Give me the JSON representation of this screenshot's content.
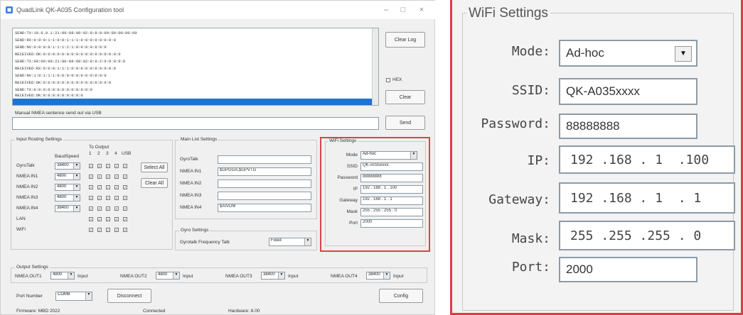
{
  "left_window": {
    "title": "QuadLink QK-A035 Configuration tool",
    "log_lines": [
      "SEND:TX:10.0.0.1:21:00:88:00:02:8:8:0:00:00:00:00:00",
      "SEND:RX:0:0:0:1:1:0:0:1:1:1:0:0:0:0:0:0:0:0",
      "SEND:NV:0:0:0:0:1:1:1:2:1:0:0:0:0:0:0:0",
      "RECEIVED:OK:0:0:0:0:0:0:0:0:0:0:0:0:0:0:0:0:0",
      "SEND:TX:00:00:00:21:00:88:00:02:8:0:2:0:0:0:0:8",
      "RECEIVED:RX:0:0:0:1:1:1:0:0:0:0:0:0:0:0:0:0",
      "SEND:NV:1:0:1:1:1:0:0:0:0:0:0:0:0:0:0:0",
      "RECEIVED:OK:0:0:0:0:0:0:0:0:0:0:0:0:0:0:0",
      "SEND:TX:0:0:0:0:0:0:0:0:0:0:0:0:0",
      "RECEIVED:OK:0:0:0:0:0:0:0:0:0"
    ],
    "buttons": {
      "clear_log": "Clear Log",
      "clear": "Clear",
      "send": "Send",
      "select_all": "Select All",
      "clear_all": "Clear All",
      "disconnect": "Disconnect",
      "config": "Config"
    },
    "hex_label": "HEX",
    "manual_label": "Manual NMEA sentence send out via USB",
    "input_routing": {
      "title": "Input Routing Settings",
      "header_baud": "BaudSpeed",
      "header_out": "To Output",
      "out_cols": [
        "1",
        "2",
        "3",
        "4",
        "USB"
      ],
      "rows": [
        {
          "label": "GyroTalk",
          "baud": "38400"
        },
        {
          "label": "NMEA IN1",
          "baud": "4800"
        },
        {
          "label": "NMEA IN2",
          "baud": "4800"
        },
        {
          "label": "NMEA IN3",
          "baud": "4800"
        },
        {
          "label": "NMEA IN4",
          "baud": "38400"
        },
        {
          "label": "LAN",
          "baud": ""
        },
        {
          "label": "WiFi",
          "baud": ""
        }
      ]
    },
    "main_list": {
      "title": "Main List Settings",
      "rows": [
        {
          "label": "GyroTalk",
          "value": ""
        },
        {
          "label": "NMEA IN1",
          "value": "$GPGGA,$GPVTG"
        },
        {
          "label": "NMEA IN2",
          "value": ""
        },
        {
          "label": "NMEA IN3",
          "value": ""
        },
        {
          "label": "NMEA IN4",
          "value": "$AIVDM"
        }
      ]
    },
    "gyro": {
      "title": "Gyro Settings",
      "label": "Gyrotalk Frequency Talk",
      "value": "Fixed"
    },
    "wifi_small": {
      "title": "WiFi Settings",
      "rows": [
        {
          "label": "Mode",
          "value": "Ad-hoc"
        },
        {
          "label": "SSID",
          "value": "QK-A035xxxx"
        },
        {
          "label": "Password",
          "value": "88888888"
        },
        {
          "label": "IP",
          "value": "192 . 168 . 1 . 100"
        },
        {
          "label": "Gateway",
          "value": "192 . 168 . 1 . 1"
        },
        {
          "label": "Mask",
          "value": "255 . 255 . 255 . 0"
        },
        {
          "label": "Port",
          "value": "2000"
        }
      ]
    },
    "output": {
      "title": "Output Settings",
      "items": [
        {
          "label": "NMEA OUT1",
          "value": "4800",
          "tag": "Input"
        },
        {
          "label": "NMEA OUT2",
          "value": "4800",
          "tag": "Input"
        },
        {
          "label": "NMEA OUT3",
          "value": "38400",
          "tag": "Input"
        },
        {
          "label": "NMEA OUT4",
          "value": "38400",
          "tag": "Input"
        }
      ]
    },
    "port_label": "Port Number",
    "port_value": "COM8",
    "status": [
      "Firmware: MBD 2022",
      "Connected",
      "Hardware: 8.00"
    ]
  },
  "wifi_zoom": {
    "title": "WiFi Settings",
    "mode_label": "Mode:",
    "mode_value": "Ad-hoc",
    "ssid_label": "SSID:",
    "ssid_value": "QK-A035xxxx",
    "password_label": "Password:",
    "password_value": "88888888",
    "ip_label": "IP:",
    "ip_value": "192 .168 . 1  .100",
    "gateway_label": "Gateway:",
    "gateway_value": "192 .168 . 1  . 1",
    "mask_label": "Mask:",
    "mask_value": "255 .255 .255 . 0",
    "port_label": "Port:",
    "port_value": "2000"
  },
  "colors": {
    "highlight": "#dc3c4a",
    "selection": "#1e73d0"
  }
}
